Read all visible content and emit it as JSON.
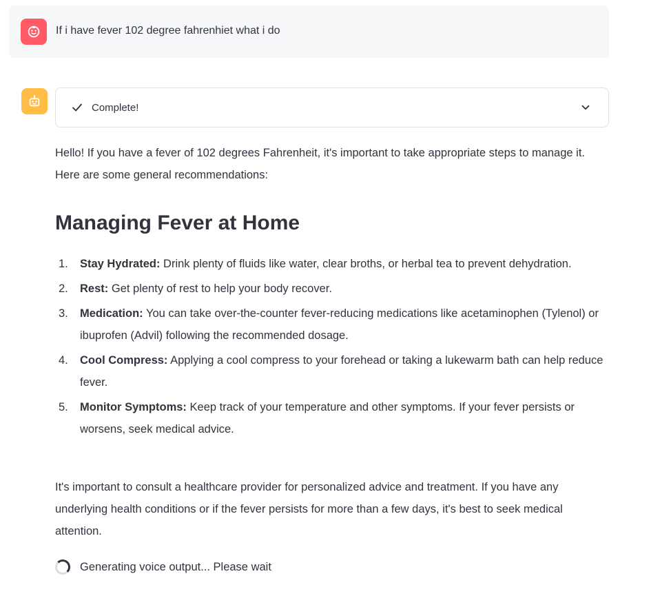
{
  "user_message": {
    "text": "If i have fever 102 degree fahrenhiet what i do",
    "avatar_icon": "face-icon",
    "avatar_color": "#ff5a65"
  },
  "assistant": {
    "avatar_icon": "robot-icon",
    "avatar_color": "#ffbd45",
    "status": {
      "label": "Complete!",
      "icon": "check-icon",
      "expand_icon": "chevron-down-icon"
    },
    "intro": "Hello! If you have a fever of 102 degrees Fahrenheit, it's important to take appropriate steps to manage it. Here are some general recommendations:",
    "heading": "Managing Fever at Home",
    "recommendations": [
      {
        "num": "1.",
        "title": "Stay Hydrated:",
        "text": "Drink plenty of fluids like water, clear broths, or herbal tea to prevent dehydration."
      },
      {
        "num": "2.",
        "title": "Rest:",
        "text": "Get plenty of rest to help your body recover."
      },
      {
        "num": "3.",
        "title": "Medication:",
        "text": "You can take over-the-counter fever-reducing medications like acetaminophen (Tylenol) or ibuprofen (Advil) following the recommended dosage."
      },
      {
        "num": "4.",
        "title": "Cool Compress:",
        "text": "Applying a cool compress to your forehead or taking a lukewarm bath can help reduce fever."
      },
      {
        "num": "5.",
        "title": "Monitor Symptoms:",
        "text": "Keep track of your temperature and other symptoms. If your fever persists or worsens, seek medical advice."
      }
    ],
    "outro": "It's important to consult a healthcare provider for personalized advice and treatment. If you have any underlying health conditions or if the fever persists for more than a few days, it's best to seek medical attention."
  },
  "generating": {
    "text": "Generating voice output... Please wait",
    "icon": "spinner-icon"
  }
}
